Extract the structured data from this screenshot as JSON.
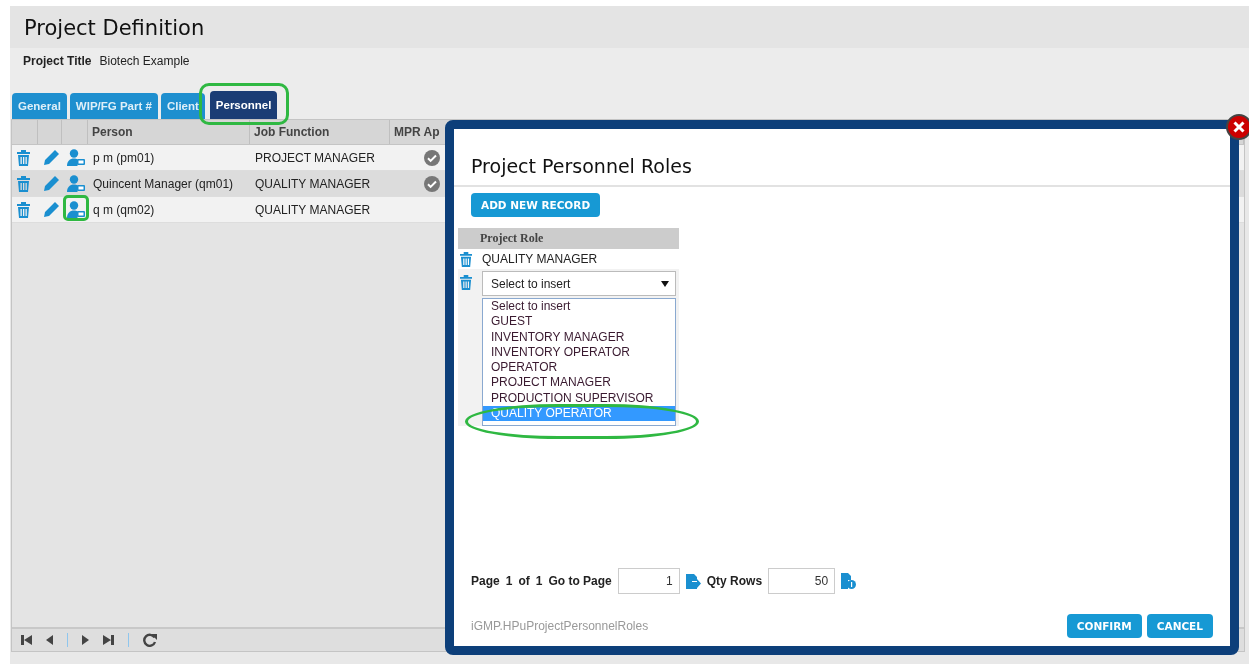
{
  "page": {
    "title": "Project Definition",
    "project_title_label": "Project Title",
    "project_title": "Biotech Example"
  },
  "tabs": [
    {
      "label": "General",
      "selected": false,
      "circled": false
    },
    {
      "label": "WIP/FG Part #",
      "selected": false,
      "circled": false
    },
    {
      "label": "Client",
      "selected": false,
      "circled": false
    },
    {
      "label": "Personnel",
      "selected": true,
      "circled": true
    }
  ],
  "table": {
    "columns": [
      "Person",
      "Job Function",
      "MPR Ap"
    ],
    "rows": [
      {
        "person": "p m (pm01)",
        "job_function": "PROJECT MANAGER",
        "mpr_approved": true,
        "icon_circled": false
      },
      {
        "person": "Quincent Manager (qm01)",
        "job_function": "QUALITY MANAGER",
        "mpr_approved": true,
        "icon_circled": false
      },
      {
        "person": "q m (qm02)",
        "job_function": "QUALITY MANAGER",
        "mpr_approved": false,
        "icon_circled": true
      }
    ]
  },
  "modal": {
    "title": "Project Personnel Roles",
    "add_button": "ADD NEW RECORD",
    "role_column": "Project Role",
    "roles": [
      "QUALITY MANAGER"
    ],
    "new_role": {
      "value": "Select to insert"
    },
    "options": [
      {
        "label": "Select to insert",
        "selected": false,
        "circled": false
      },
      {
        "label": "GUEST",
        "selected": false,
        "circled": false
      },
      {
        "label": "INVENTORY MANAGER",
        "selected": false,
        "circled": false
      },
      {
        "label": "INVENTORY OPERATOR",
        "selected": false,
        "circled": false
      },
      {
        "label": "OPERATOR",
        "selected": false,
        "circled": false
      },
      {
        "label": "PROJECT MANAGER",
        "selected": false,
        "circled": false
      },
      {
        "label": "PRODUCTION SUPERVISOR",
        "selected": false,
        "circled": false
      },
      {
        "label": "QUALITY OPERATOR",
        "selected": true,
        "circled": true
      }
    ],
    "pager": {
      "page_label": "Page",
      "page": "1",
      "of_label": "of",
      "pages": "1",
      "goto_label": "Go to Page",
      "goto_value": "1",
      "qty_label": "Qty Rows",
      "qty_value": "50"
    },
    "form_id": "iGMP.HPuProjectPersonnelRoles",
    "buttons": [
      "CONFIRM",
      "CANCEL"
    ]
  }
}
